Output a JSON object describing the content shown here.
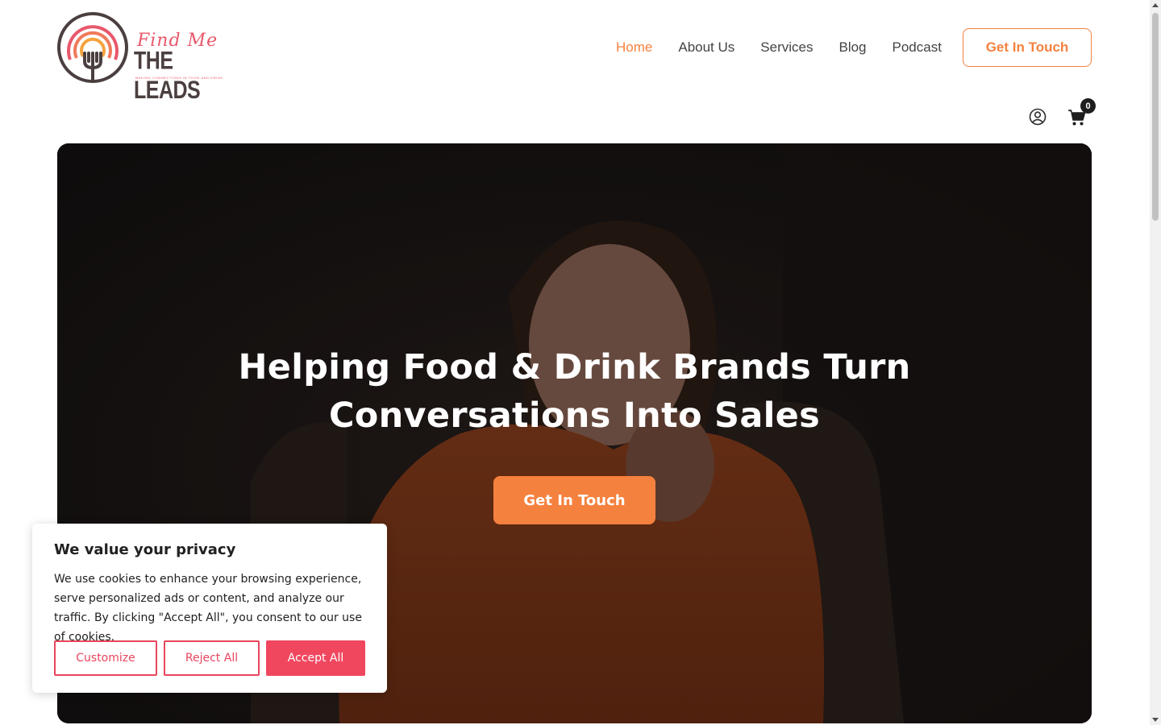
{
  "header": {
    "logo": {
      "script_text": "Find Me",
      "main_text": "THE LEADS",
      "tagline": "MAKING CONNECTIONS IN FOOD AND DRINK",
      "colors": {
        "ring_outer": "#4b3f3f",
        "ring_pink": "#e8586b",
        "ring_orange": "#f5a33f"
      }
    },
    "nav": [
      {
        "label": "Home",
        "active": true
      },
      {
        "label": "About Us",
        "active": false
      },
      {
        "label": "Services",
        "active": false
      },
      {
        "label": "Blog",
        "active": false
      },
      {
        "label": "Podcast",
        "active": false
      }
    ],
    "cta_label": "Get In Touch",
    "user_icon": "user-circle-icon",
    "cart_icon": "shopping-cart-icon",
    "cart_count": "0"
  },
  "hero": {
    "title_line1": "Helping Food & Drink Brands Turn",
    "title_line2": "Conversations Into Sales",
    "cta_label": "Get In Touch"
  },
  "cookie_banner": {
    "title": "We value your privacy",
    "body": "We use cookies to enhance your browsing experience, serve personalized ads or content, and analyze our traffic. By clicking \"Accept All\", you consent to our use of cookies.",
    "buttons": {
      "customize": "Customize",
      "reject": "Reject All",
      "accept": "Accept All"
    }
  },
  "colors": {
    "accent": "#f5813f",
    "cookie_accent": "#f0475f",
    "text": "#444444"
  }
}
